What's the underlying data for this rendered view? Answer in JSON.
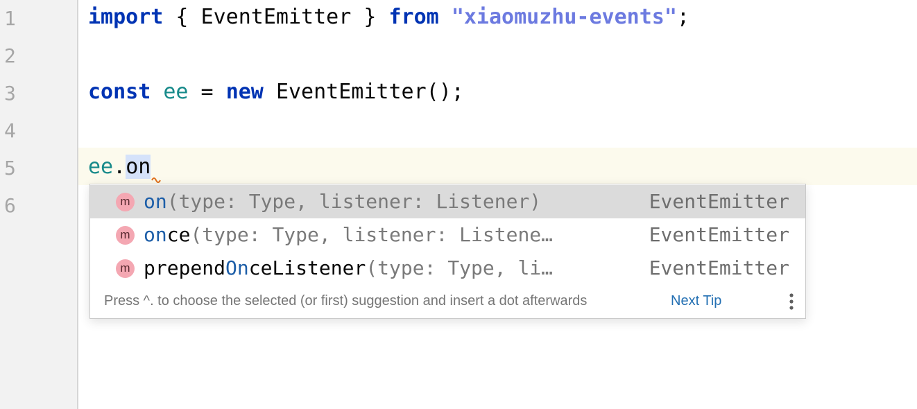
{
  "editor": {
    "line_numbers": [
      "1",
      "2",
      "3",
      "4",
      "5",
      "6"
    ],
    "line1": {
      "kw_import": "import",
      "brace_open": " { ",
      "ident": "EventEmitter",
      "brace_close": " } ",
      "kw_from": "from",
      "space": " ",
      "string": "\"xiaomuzhu-events\"",
      "semi": ";"
    },
    "line3": {
      "kw_const": "const",
      "sp1": " ",
      "var": "ee",
      "eq": " = ",
      "kw_new": "new",
      "sp2": " ",
      "call": "EventEmitter();"
    },
    "line5": {
      "var": "ee",
      "dot": ".",
      "typed": "on"
    }
  },
  "completion": {
    "items": [
      {
        "badge": "m",
        "match": "on",
        "rest": "",
        "params": "(type: Type, listener: Listener)",
        "owner": "EventEmitter"
      },
      {
        "badge": "m",
        "match": "on",
        "rest": "ce",
        "params": "(type: Type, listener: Listene…",
        "owner": "EventEmitter"
      },
      {
        "badge": "m",
        "prefix": "prepend",
        "match": "On",
        "rest": "ceListener",
        "params": "(type: Type, li…",
        "owner": "EventEmitter"
      }
    ],
    "tip_text": "Press ^. to choose the selected (or first) suggestion and insert a dot afterwards",
    "tip_link": "Next Tip"
  },
  "colors": {
    "keyword": "#0033b3",
    "string": "#6c7ae0",
    "variable": "#178a8a",
    "match": "#1d5ea8",
    "selected_row": "#dbdbdb",
    "current_line": "#fcfaed",
    "method_badge": "#f4a7b2",
    "link": "#2470b3"
  },
  "icons": {
    "method_badge": "method-badge-icon",
    "more": "kebab-menu-icon",
    "warning": "warning-squiggle-icon"
  }
}
